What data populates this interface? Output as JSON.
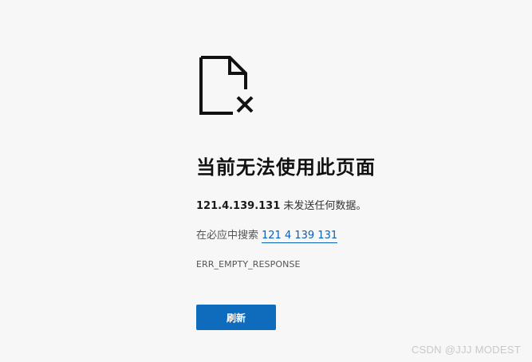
{
  "error_page": {
    "icon": "broken-document-icon",
    "title": "当前无法使用此页面",
    "host": "121.4.139.131",
    "detail_text": " 未发送任何数据。",
    "search_prefix": "在必应中搜索",
    "search_link": "121 4 139 131",
    "error_code": "ERR_EMPTY_RESPONSE",
    "refresh_label": "刷新"
  },
  "watermark": "CSDN @JJJ MODEST",
  "colors": {
    "background": "#f7f7f7",
    "accent": "#0f6cbd",
    "link": "#0a5fb4"
  }
}
